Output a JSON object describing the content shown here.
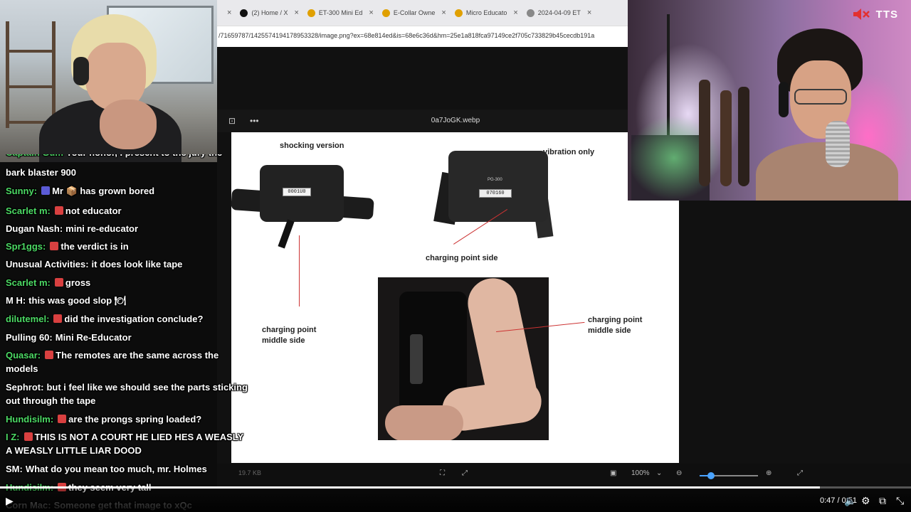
{
  "overlay": {
    "tts_label": "TTS",
    "colors": {
      "mute_icon": "#e33030"
    }
  },
  "browser": {
    "tabs": [
      {
        "title": "",
        "icon": "x-icon",
        "color": "#000000"
      },
      {
        "title": "(2) Home / X",
        "icon": "x-logo-icon",
        "color": "#111111"
      },
      {
        "title": "ET-300 Mini Ed",
        "icon": "site-icon",
        "color": "#e0a000"
      },
      {
        "title": "E-Collar Owne",
        "icon": "site-icon",
        "color": "#e0a000"
      },
      {
        "title": "Micro Educato",
        "icon": "site-icon",
        "color": "#e0a000"
      },
      {
        "title": "2024-04-09 ET",
        "icon": "globe-icon",
        "color": "#888888"
      }
    ],
    "address": "/71659787/1425574194178953328/image.png?ex=68e814ed&is=68e6c36d&hm=25e1a818fca97149ce2f705c733829b45cecdb191a"
  },
  "viewer": {
    "filename": "0a7JoGK.webp",
    "image_labels": {
      "shocking": "shocking version",
      "vibration": "vibration only",
      "charging_side": "charging point side",
      "charging_middle_left": "charging point\nmiddle side",
      "charging_middle_right": "charging point\nmiddle side",
      "screen_left": "0001U0",
      "model_right": "PG-300",
      "screen_right": "070160"
    },
    "file_size": "19.7 KB",
    "zoom": "100%",
    "zoom_level": 0.2
  },
  "chat": [
    {
      "user": "Captain Gum",
      "color": "#4cd964",
      "text": "Your honor, I present to the jury the",
      "cut": true
    },
    {
      "user": "",
      "color": "#ffffff",
      "text": "bark blaster 900"
    },
    {
      "user": "Sunny:",
      "color": "#4cd964",
      "badge": "#5b5bd6",
      "text": "Mr 📦 has grown bored"
    },
    {
      "user": "Scarlet m:",
      "color": "#4cd964",
      "badge": "#d94040",
      "text": "not educator"
    },
    {
      "user": "Dugan Nash:",
      "color": "#ffffff",
      "text": "mini re-educator"
    },
    {
      "user": "Spr1ggs:",
      "color": "#4cd964",
      "badge": "#d94040",
      "text": "the verdict is in"
    },
    {
      "user": "Unusual Activities:",
      "color": "#ffffff",
      "text": "it does look like tape"
    },
    {
      "user": "Scarlet m:",
      "color": "#4cd964",
      "badge": "#d94040",
      "text": "gross"
    },
    {
      "user": "M H:",
      "color": "#ffffff",
      "text": "this was good slop 🍽"
    },
    {
      "user": "dilutemel:",
      "color": "#4cd964",
      "badge": "#d94040",
      "text": "did the investigation conclude?"
    },
    {
      "user": "Pulling 60:",
      "color": "#ffffff",
      "text": "Mini Re-Educator"
    },
    {
      "user": "Quasar:",
      "color": "#4cd964",
      "badge": "#d94040",
      "text": "The remotes are the same across the models"
    },
    {
      "user": "Sephrot:",
      "color": "#ffffff",
      "text": "but i feel like we should see the parts sticking out through the tape"
    },
    {
      "user": "Hundisilm:",
      "color": "#4cd964",
      "badge": "#d94040",
      "text": "are the prongs spring loaded?"
    },
    {
      "user": "I Z:",
      "color": "#4cd964",
      "badge": "#d94040",
      "text": "THIS IS NOT A COURT HE LIED HES A WEASLY A WEASLY LITTLE LIAR DOOD"
    },
    {
      "user": "SM:",
      "color": "#ffffff",
      "text": "What do you mean too much, mr. Holmes"
    },
    {
      "user": "Hundisilm:",
      "color": "#4cd964",
      "badge": "#d94040",
      "text": "they seem very tall"
    },
    {
      "user": "Corn Mac:",
      "color": "#ffffff",
      "text": "Someone get that image to xQc",
      "dim": true
    }
  ],
  "player": {
    "time": "0:47 / 0:51",
    "progress": 0.9
  }
}
